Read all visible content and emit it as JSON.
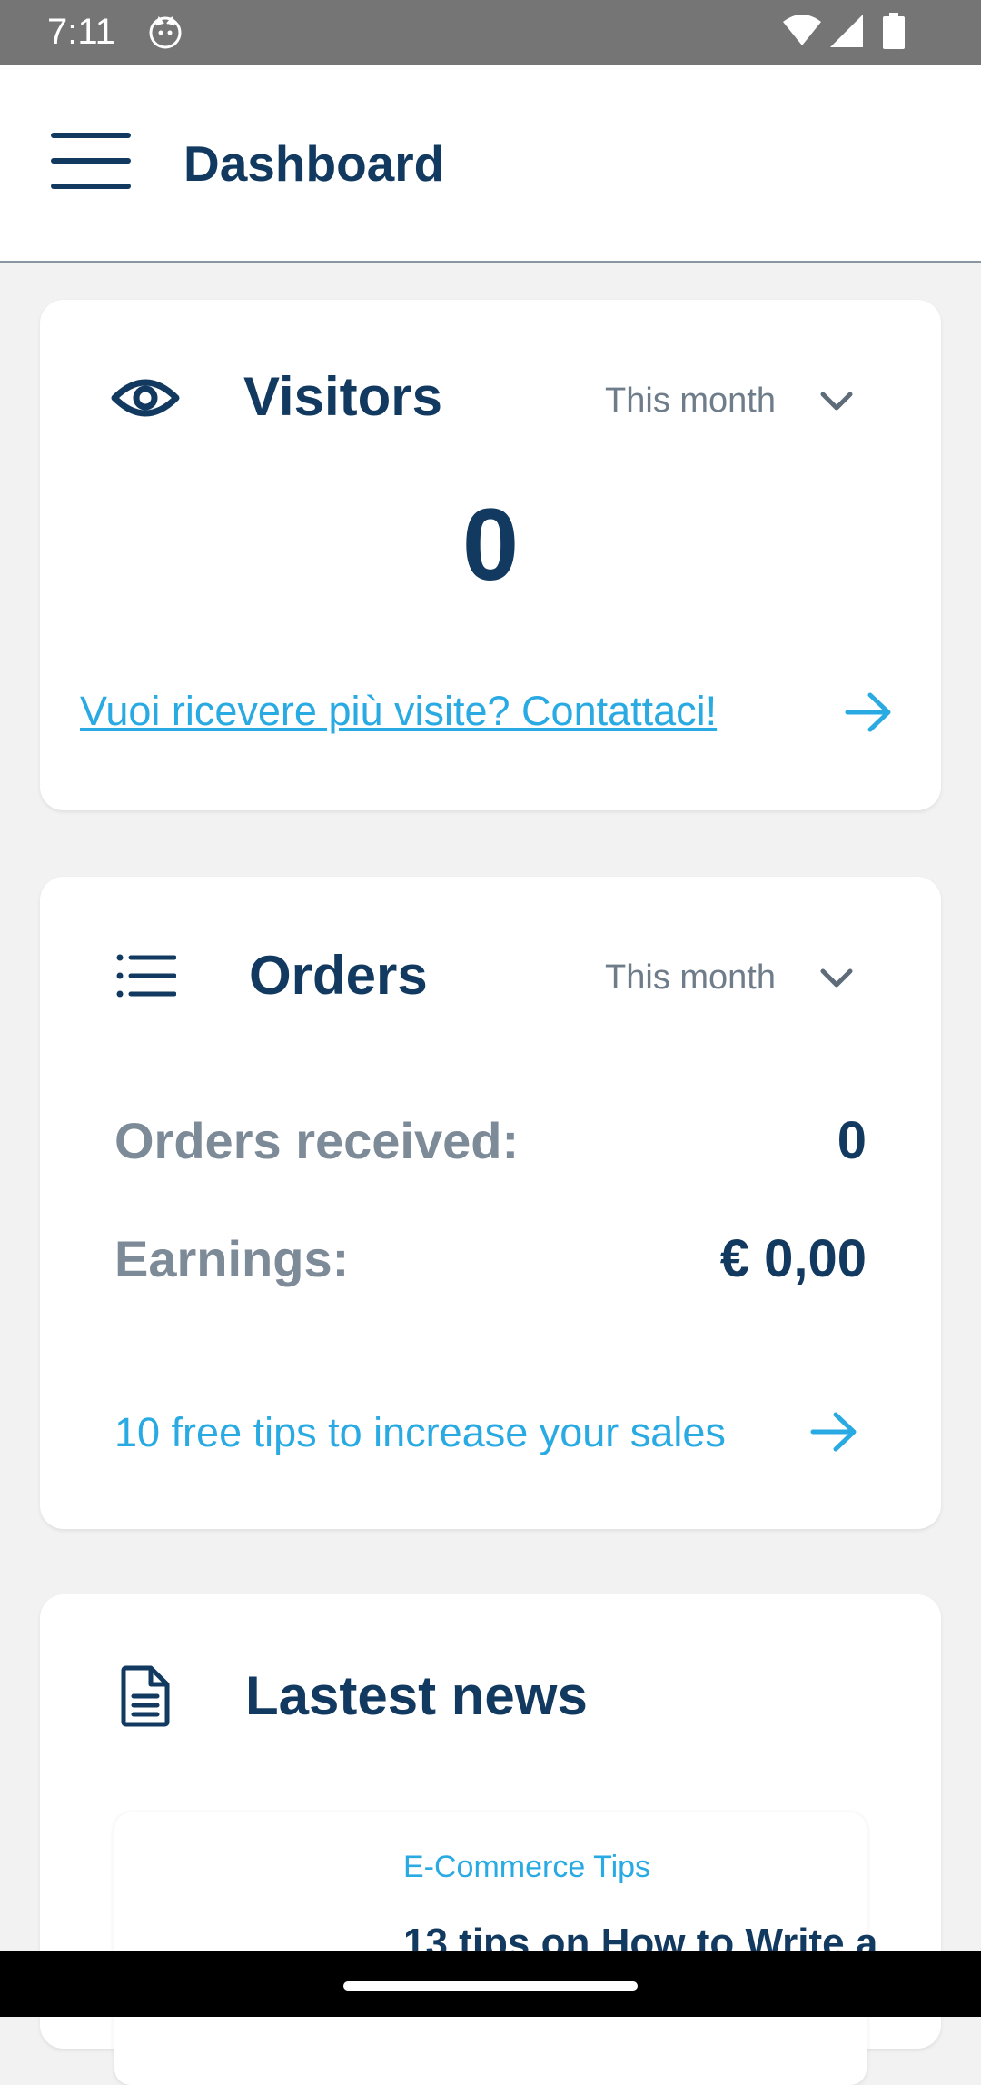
{
  "status_bar": {
    "time": "7:11",
    "icons": [
      "cat-notification-icon",
      "wifi-icon",
      "signal-icon",
      "battery-icon"
    ]
  },
  "app_bar": {
    "title": "Dashboard",
    "menu_icon": "hamburger-menu-icon"
  },
  "visitors_card": {
    "icon": "eye-icon",
    "title": "Visitors",
    "period": "This month",
    "count": "0",
    "link_text": "Vuoi ricevere più visite? Contattaci!"
  },
  "orders_card": {
    "icon": "list-icon",
    "title": "Orders",
    "period": "This month",
    "rows": [
      {
        "label": "Orders received:",
        "value": "0"
      },
      {
        "label": "Earnings:",
        "value": "€ 0,00"
      }
    ],
    "link_text": "10 free tips to increase your sales"
  },
  "news_card": {
    "icon": "document-icon",
    "title": "Lastest news",
    "items": [
      {
        "category": "E-Commerce Tips",
        "headline": "13 tips on How to Write a"
      }
    ]
  },
  "colors": {
    "primary": "#12395f",
    "accent": "#29aae2",
    "muted": "#7d8a97",
    "status_bar": "#757575",
    "background": "#f2f2f2"
  }
}
